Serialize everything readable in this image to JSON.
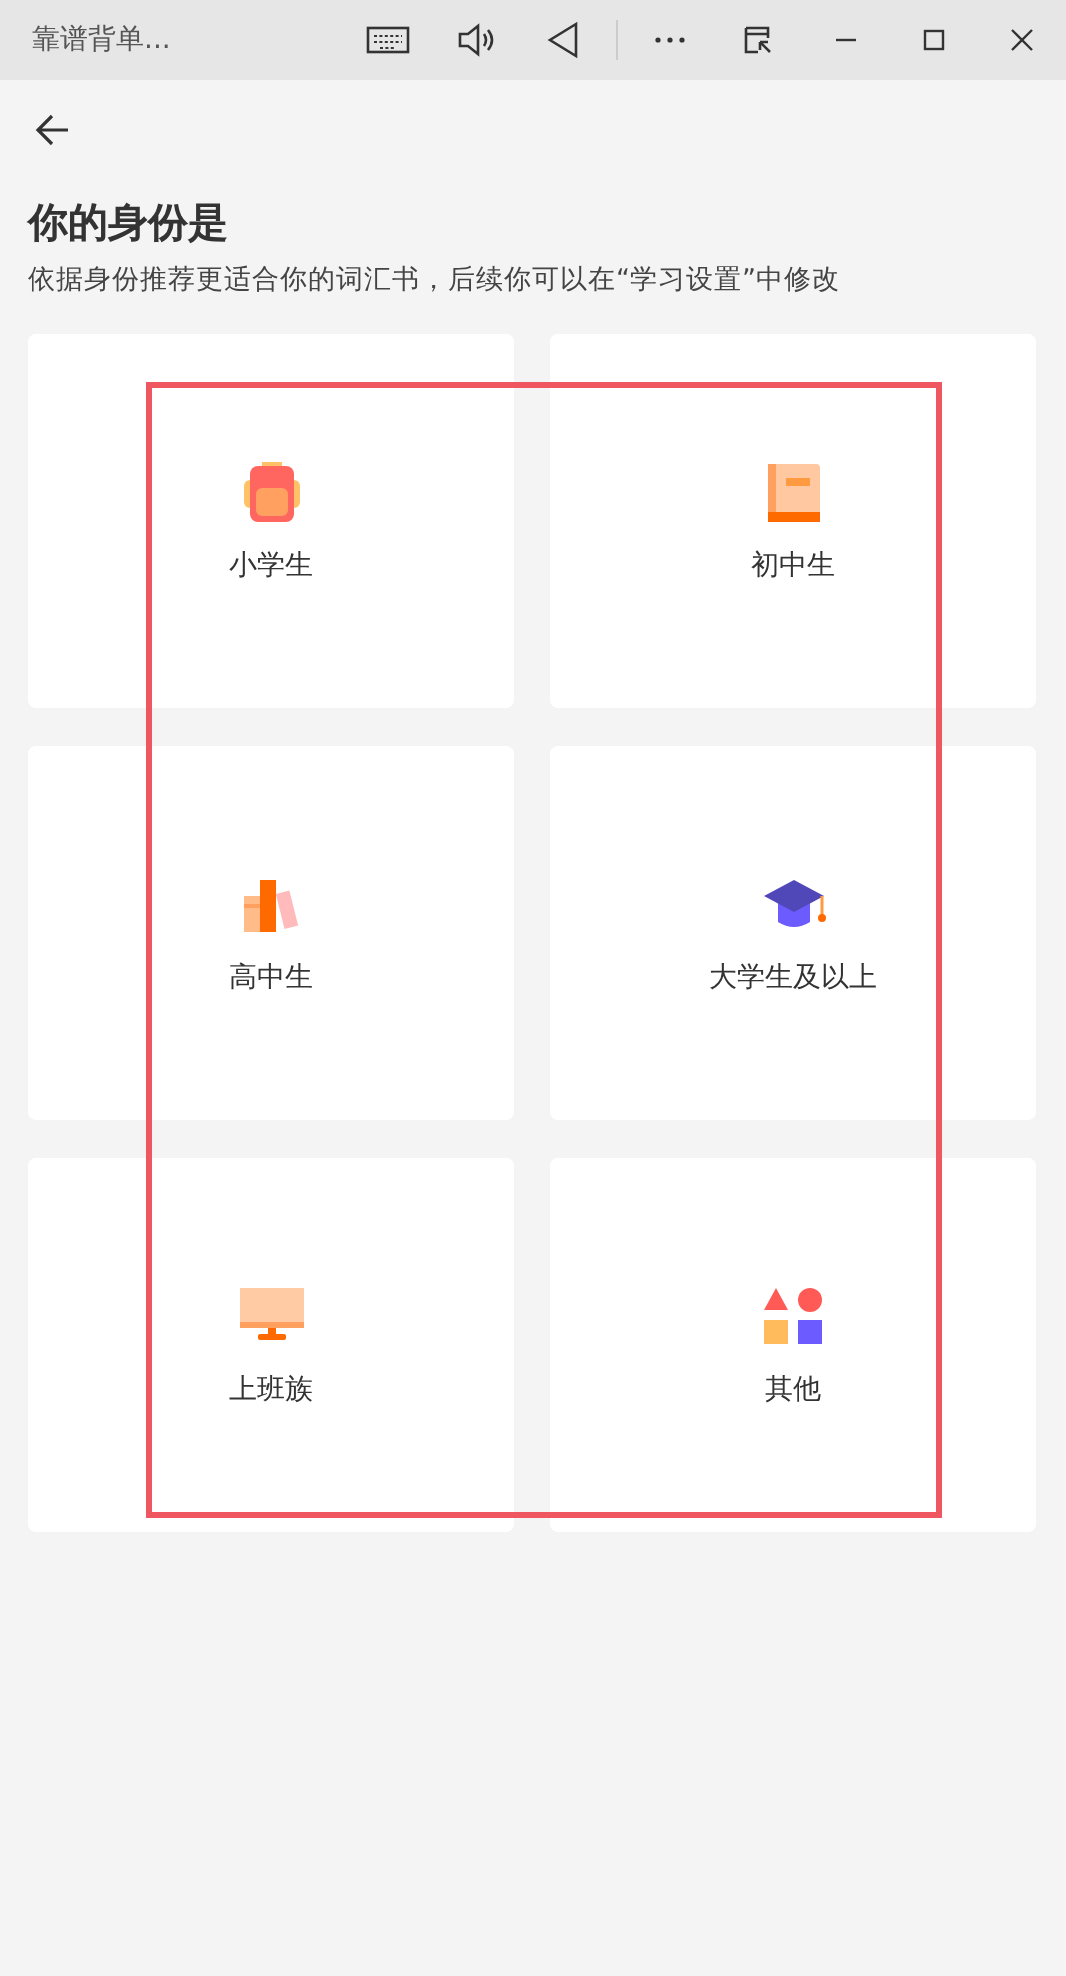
{
  "window": {
    "title": "靠谱背单..."
  },
  "heading": "你的身份是",
  "subtitle": "依据身份推荐更适合你的词汇书，后续你可以在“学习设置”中修改",
  "options": [
    {
      "kind": "backpack",
      "label": "小学生"
    },
    {
      "kind": "book",
      "label": "初中生"
    },
    {
      "kind": "books",
      "label": "高中生"
    },
    {
      "kind": "cap",
      "label": "大学生及以上"
    },
    {
      "kind": "monitor",
      "label": "上班族"
    },
    {
      "kind": "shapes",
      "label": "其他"
    }
  ]
}
